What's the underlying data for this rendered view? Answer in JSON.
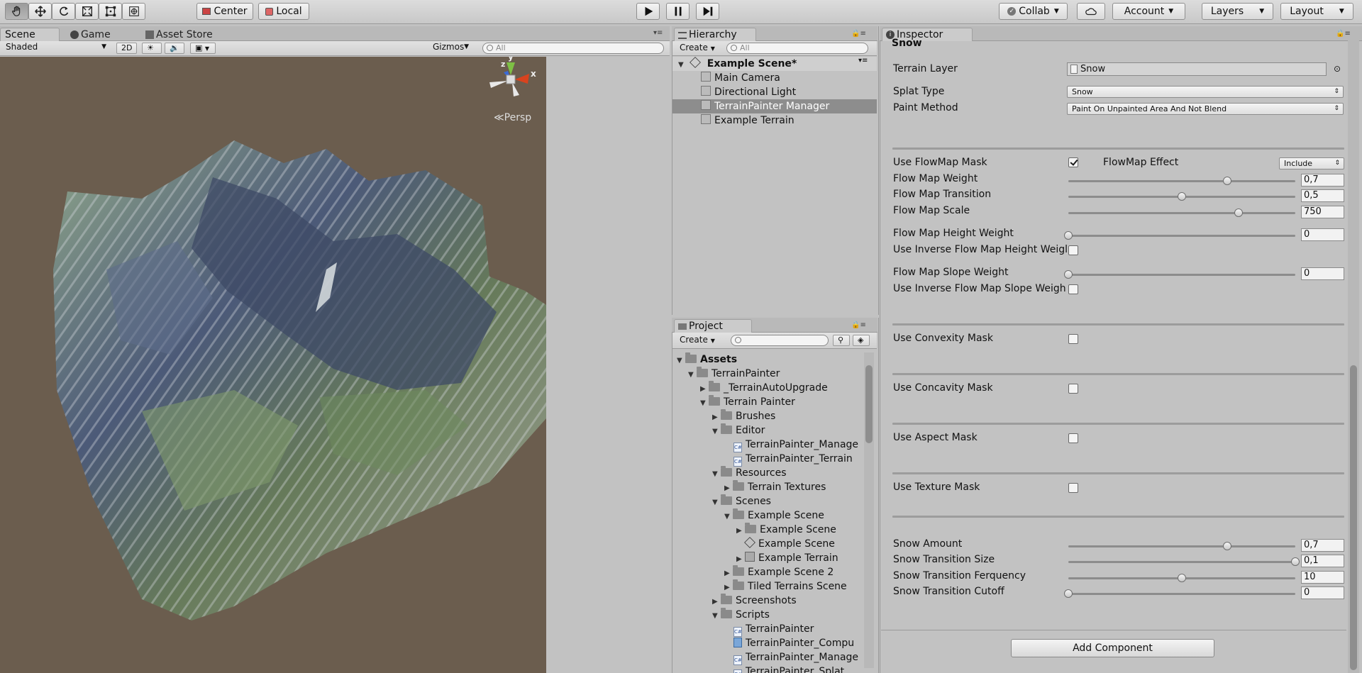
{
  "toolbar": {
    "tools": [
      "hand-tool",
      "move-tool",
      "rotate-tool",
      "scale-tool",
      "rect-tool",
      "transform-tool"
    ],
    "pivot_label": "Center",
    "space_label": "Local",
    "play": "play",
    "pause": "pause",
    "step": "step",
    "collab_label": "Collab",
    "account_label": "Account",
    "layers_label": "Layers",
    "layout_label": "Layout"
  },
  "scene": {
    "tabs": [
      "Scene",
      "Game",
      "Asset Store"
    ],
    "shading": "Shaded",
    "mode_2d": "2D",
    "gizmos_label": "Gizmos",
    "search_placeholder": "All",
    "persp_label": "Persp",
    "gizmo_axes": {
      "x": "x",
      "y": "y",
      "z": "z"
    }
  },
  "hierarchy": {
    "tab": "Hierarchy",
    "create_label": "Create",
    "search_placeholder": "All",
    "scene_name": "Example Scene*",
    "items": [
      "Main Camera",
      "Directional Light",
      "TerrainPainter Manager",
      "Example Terrain"
    ],
    "selected_index": 2
  },
  "project": {
    "tab": "Project",
    "create_label": "Create",
    "tree": [
      {
        "label": "Assets",
        "type": "folder",
        "bold": true
      },
      {
        "label": "TerrainPainter",
        "type": "folder"
      },
      {
        "label": "_TerrainAutoUpgrade",
        "type": "folder"
      },
      {
        "label": "Terrain Painter",
        "type": "folder"
      },
      {
        "label": "Brushes",
        "type": "folder"
      },
      {
        "label": "Editor",
        "type": "folder"
      },
      {
        "label": "TerrainPainter_Manage",
        "type": "script"
      },
      {
        "label": "TerrainPainter_Terrain",
        "type": "script"
      },
      {
        "label": "Resources",
        "type": "folder"
      },
      {
        "label": "Terrain Textures",
        "type": "folder"
      },
      {
        "label": "Scenes",
        "type": "folder"
      },
      {
        "label": "Example Scene",
        "type": "folder"
      },
      {
        "label": "Example Scene",
        "type": "folder"
      },
      {
        "label": "Example Scene",
        "type": "unity"
      },
      {
        "label": "Example Terrain",
        "type": "prefab"
      },
      {
        "label": "Example Scene 2",
        "type": "folder"
      },
      {
        "label": "Tiled Terrains Scene",
        "type": "folder"
      },
      {
        "label": "Screenshots",
        "type": "folder"
      },
      {
        "label": "Scripts",
        "type": "folder"
      },
      {
        "label": "TerrainPainter",
        "type": "script"
      },
      {
        "label": "TerrainPainter_Compu",
        "type": "compute"
      },
      {
        "label": "TerrainPainter_Manage",
        "type": "script"
      },
      {
        "label": "TerrainPainter_Splat",
        "type": "script"
      }
    ]
  },
  "inspector": {
    "tab": "Inspector",
    "header": "Snow",
    "terrain_layer_label": "Terrain Layer",
    "terrain_layer_value": "Snow",
    "splat_type_label": "Splat Type",
    "splat_type_value": "Snow",
    "paint_method_label": "Paint Method",
    "paint_method_value": "Paint On Unpainted Area And Not Blend",
    "use_flowmap_label": "Use FlowMap Mask",
    "use_flowmap_checked": true,
    "flowmap_effect_label": "FlowMap Effect",
    "flowmap_effect_value": "Include",
    "flow_weight_label": "Flow Map Weight",
    "flow_weight_value": "0,7",
    "flow_weight_fraction": 0.7,
    "flow_transition_label": "Flow Map Transition",
    "flow_transition_value": "0,5",
    "flow_transition_fraction": 0.5,
    "flow_scale_label": "Flow Map Scale",
    "flow_scale_value": "750",
    "flow_scale_fraction": 0.75,
    "flow_height_weight_label": "Flow Map Height Weight",
    "flow_height_weight_value": "0",
    "flow_height_weight_fraction": 0,
    "inverse_height_label": "Use Inverse Flow Map Height Weigl",
    "flow_slope_weight_label": "Flow Map Slope Weight",
    "flow_slope_weight_value": "0",
    "flow_slope_weight_fraction": 0,
    "inverse_slope_label": "Use Inverse Flow Map Slope Weigh",
    "convexity_label": "Use Convexity Mask",
    "concavity_label": "Use Concavity Mask",
    "aspect_label": "Use Aspect Mask",
    "texture_label": "Use Texture Mask",
    "snow_amount_label": "Snow Amount",
    "snow_amount_value": "0,7",
    "snow_amount_fraction": 0.7,
    "snow_transition_size_label": "Snow Transition Size",
    "snow_transition_size_value": "0,1",
    "snow_transition_size_fraction": 1,
    "snow_transition_freq_label": "Snow Transition Ferquency",
    "snow_transition_freq_value": "10",
    "snow_transition_freq_fraction": 0.5,
    "snow_cutoff_label": "Snow Transition Cutoff",
    "snow_cutoff_value": "0",
    "snow_cutoff_fraction": 0,
    "add_component_label": "Add Component"
  },
  "colors": {
    "scene_bg": "#6b5d4e",
    "selection": "#8d8d8d",
    "panel": "#c2c2c2"
  }
}
